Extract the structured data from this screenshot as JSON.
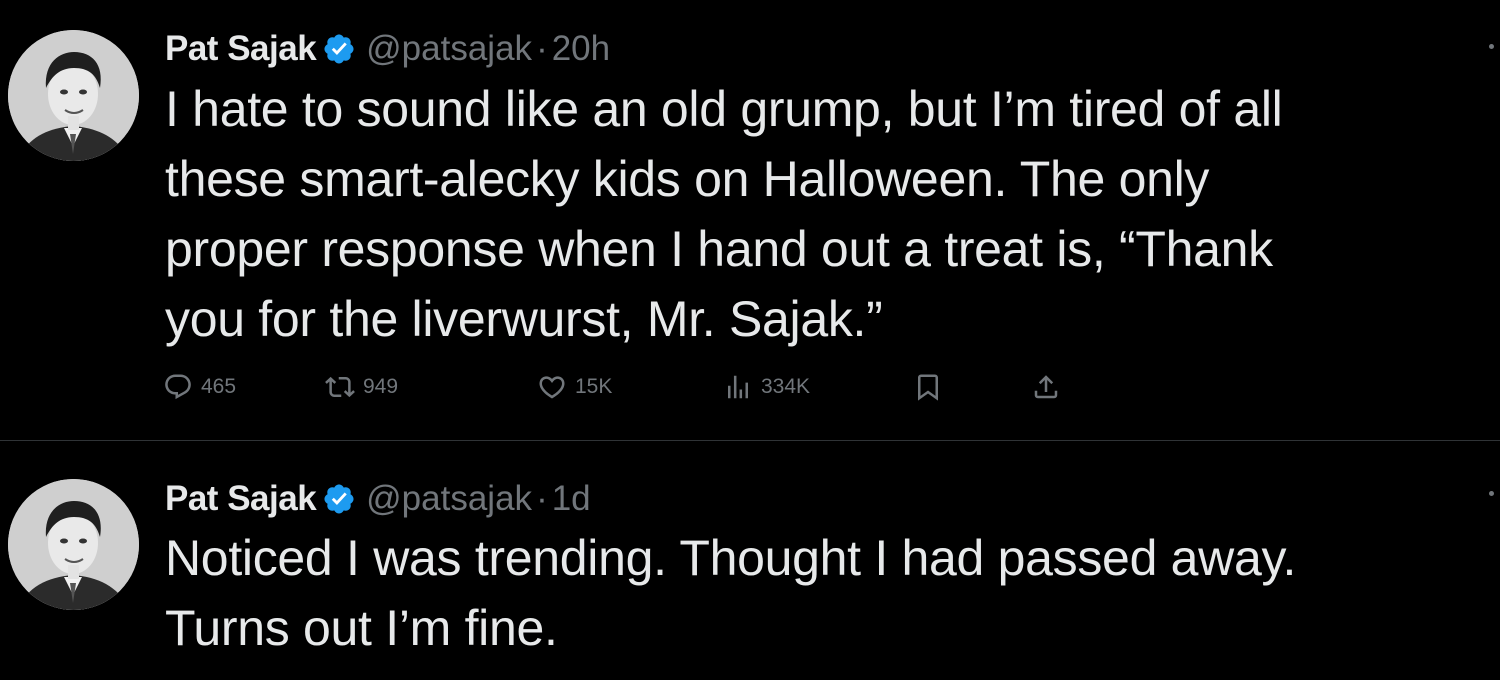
{
  "tweets": [
    {
      "display_name": "Pat Sajak",
      "handle": "@patsajak",
      "separator": "·",
      "time": "20h",
      "text": "I hate to sound like an old grump, but I’m tired of all\nthese smart-alecky kids on Halloween. The only\nproper response when I hand out a treat is, “Thank\nyou for the liverwurst, Mr. Sajak.”",
      "stats": {
        "replies": "465",
        "retweets": "949",
        "likes": "15K",
        "views": "334K"
      }
    },
    {
      "display_name": "Pat Sajak",
      "handle": "@patsajak",
      "separator": "·",
      "time": "1d",
      "text": "Noticed I was trending. Thought I had passed away.\nTurns out I’m fine."
    }
  ],
  "icons": {
    "verified": "verified-badge-icon",
    "reply": "reply-icon",
    "retweet": "retweet-icon",
    "like": "heart-icon",
    "views": "views-icon",
    "bookmark": "bookmark-icon",
    "share": "share-icon"
  },
  "colors": {
    "background": "#000000",
    "text": "#e7e9ea",
    "secondary": "#71767b",
    "verified": "#1d9bf0",
    "divider": "#2f3336"
  }
}
